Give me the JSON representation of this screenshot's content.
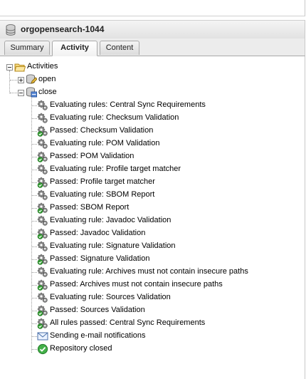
{
  "panel": {
    "title": "orgopensearch-1044"
  },
  "tabs": [
    {
      "label": "Summary",
      "active": false
    },
    {
      "label": "Activity",
      "active": true
    },
    {
      "label": "Content",
      "active": false
    }
  ],
  "tree": {
    "root_label": "Activities",
    "open_label": "open",
    "close_label": "close",
    "close_children": [
      {
        "label": "Evaluating rules: Central Sync Requirements",
        "icon": "gear-icon"
      },
      {
        "label": "Evaluating rule: Checksum Validation",
        "icon": "gear-icon"
      },
      {
        "label": "Passed: Checksum Validation",
        "icon": "gear-passed-icon"
      },
      {
        "label": "Evaluating rule: POM Validation",
        "icon": "gear-icon"
      },
      {
        "label": "Passed: POM Validation",
        "icon": "gear-passed-icon"
      },
      {
        "label": "Evaluating rule: Profile target matcher",
        "icon": "gear-icon"
      },
      {
        "label": "Passed: Profile target matcher",
        "icon": "gear-passed-icon"
      },
      {
        "label": "Evaluating rule: SBOM Report",
        "icon": "gear-icon"
      },
      {
        "label": "Passed: SBOM Report",
        "icon": "gear-passed-icon"
      },
      {
        "label": "Evaluating rule: Javadoc Validation",
        "icon": "gear-icon"
      },
      {
        "label": "Passed: Javadoc Validation",
        "icon": "gear-passed-icon"
      },
      {
        "label": "Evaluating rule: Signature Validation",
        "icon": "gear-icon"
      },
      {
        "label": "Passed: Signature Validation",
        "icon": "gear-passed-icon"
      },
      {
        "label": "Evaluating rule: Archives must not contain insecure paths",
        "icon": "gear-icon"
      },
      {
        "label": "Passed: Archives must not contain insecure paths",
        "icon": "gear-passed-icon"
      },
      {
        "label": "Evaluating rule: Sources Validation",
        "icon": "gear-icon"
      },
      {
        "label": "Passed: Sources Validation",
        "icon": "gear-passed-icon"
      },
      {
        "label": "All rules passed: Central Sync Requirements",
        "icon": "gear-passed-icon"
      },
      {
        "label": "Sending e-mail notifications",
        "icon": "envelope-icon"
      },
      {
        "label": "Repository closed",
        "icon": "check-circle-icon"
      }
    ]
  }
}
